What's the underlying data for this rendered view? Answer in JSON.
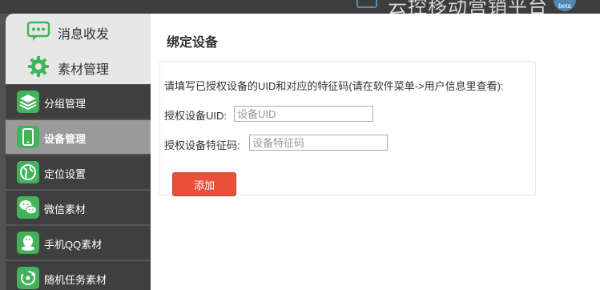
{
  "header": {
    "platform_title": "云控移动营销平台",
    "avatar_text": "beta"
  },
  "sidebar": {
    "groups": [
      {
        "label": "消息收发",
        "icon": "chat-bubble-icon"
      },
      {
        "label": "素材管理",
        "icon": "gear-icon"
      }
    ],
    "items": [
      {
        "label": "分组管理",
        "icon": "layers-icon",
        "active": false
      },
      {
        "label": "设备管理",
        "icon": "phone-icon",
        "active": true
      },
      {
        "label": "定位设置",
        "icon": "globe-icon",
        "active": false
      },
      {
        "label": "微信素材",
        "icon": "wechat-icon",
        "active": false
      },
      {
        "label": "手机QQ素材",
        "icon": "qq-icon",
        "active": false
      },
      {
        "label": "随机任务素材",
        "icon": "random-task-icon",
        "active": false
      }
    ]
  },
  "main": {
    "title": "绑定设备",
    "instruction": "请填写已授权设备的UID和对应的特征码(请在软件菜单->用户信息里查看):",
    "uid_label": "授权设备UID:",
    "uid_placeholder": "设备UID",
    "uid_value": "",
    "code_label": "授权设备特征码:",
    "code_placeholder": "设备特征码",
    "code_value": "",
    "add_button": "添加"
  },
  "colors": {
    "sidebar_bg": "#535353",
    "nav_item_bg": "#3f3f3f",
    "nav_active_bg": "#9a9a9a",
    "icon_green": "#43b35b",
    "button_red": "#e9503b"
  }
}
